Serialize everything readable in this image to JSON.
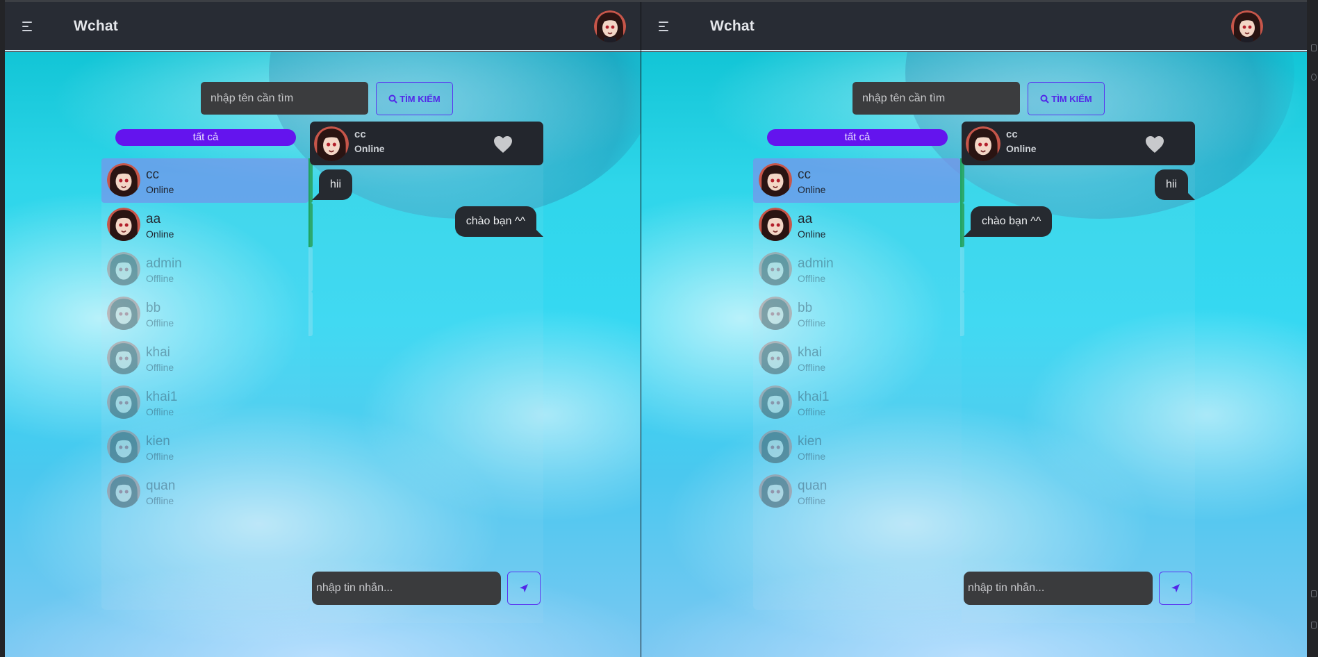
{
  "app": {
    "title": "Wchat"
  },
  "navbar": {
    "menu_icon": "menu-icon",
    "avatar_icon": "user-avatar"
  },
  "search": {
    "placeholder": "nhập tên cần tìm",
    "button_label": "TÌM KIẾM",
    "button_icon": "search-icon"
  },
  "filter": {
    "label": "tất cả"
  },
  "contacts": [
    {
      "name": "cc",
      "status": "Online"
    },
    {
      "name": "aa",
      "status": "Online"
    },
    {
      "name": "admin",
      "status": "Offline"
    },
    {
      "name": "bb",
      "status": "Offline"
    },
    {
      "name": "khai",
      "status": "Offline"
    },
    {
      "name": "khai1",
      "status": "Offline"
    },
    {
      "name": "kien",
      "status": "Offline"
    },
    {
      "name": "quan",
      "status": "Offline"
    }
  ],
  "chat": {
    "contact_name": "cc",
    "contact_status": "Online",
    "favorite_icon": "heart-icon",
    "messages": [
      {
        "text": "hii"
      },
      {
        "text": "chào bạn ^^"
      }
    ],
    "composer_placeholder": "nhập tin nhắn...",
    "send_icon": "send-icon"
  },
  "colors": {
    "navbar": "#282c34",
    "accent": "#6414ee",
    "online_bar": "#1fa463",
    "bubble": "#262a30"
  }
}
